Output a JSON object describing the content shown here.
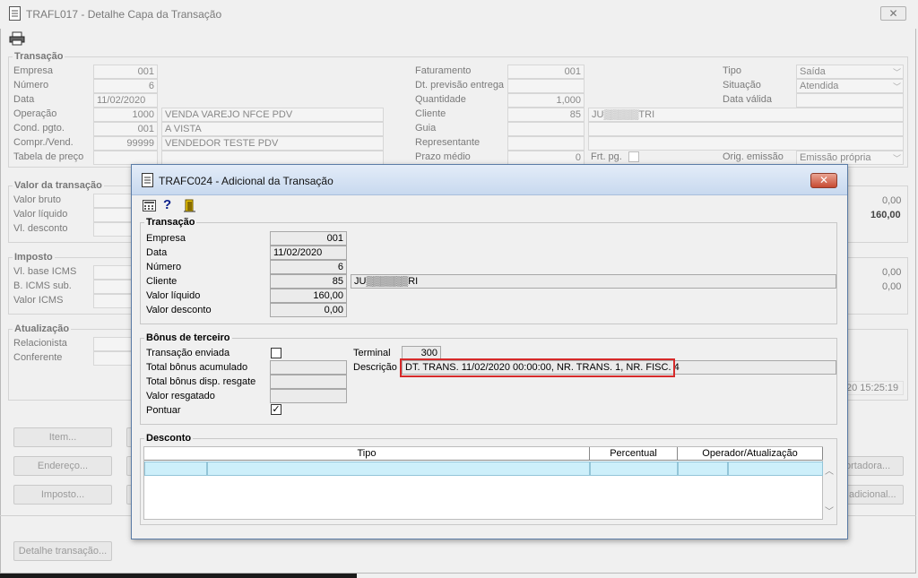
{
  "main": {
    "title": "TRAFL017 - Detalhe Capa da Transação",
    "close": "✕",
    "transacao": {
      "title": "Transação",
      "empresa_label": "Empresa",
      "empresa": "001",
      "numero_label": "Número",
      "numero": "6",
      "data_label": "Data",
      "data": "11/02/2020",
      "operacao_label": "Operação",
      "operacao_code": "1000",
      "operacao_desc": "VENDA VAREJO NFCE PDV",
      "cond_label": "Cond. pgto.",
      "cond_code": "001",
      "cond_desc": "A VISTA",
      "compr_label": "Compr./Vend.",
      "compr_code": "99999",
      "compr_desc": "VENDEDOR TESTE PDV",
      "tabela_label": "Tabela de preço",
      "faturamento_label": "Faturamento",
      "faturamento": "001",
      "dt_prev_label": "Dt. previsão entrega",
      "quantidade_label": "Quantidade",
      "quantidade": "1,000",
      "cliente_label": "Cliente",
      "cliente_code": "85",
      "cliente_name": "JU▒▒▒▒▒TRI",
      "guia_label": "Guia",
      "representante_label": "Representante",
      "prazo_label": "Prazo médio",
      "prazo": "0",
      "frt_label": "Frt. pg.",
      "tipo_label": "Tipo",
      "tipo": "Saída",
      "situacao_label": "Situação",
      "situacao": "Atendida",
      "data_valida_label": "Data válida",
      "orig_label": "Orig. emissão",
      "orig": "Emissão própria"
    },
    "valor": {
      "title": "Valor da transação",
      "bruto_label": "Valor bruto",
      "liquido_label": "Valor líquido",
      "desconto_label": "Vl. desconto",
      "right1": "0,00",
      "right2": "160,00"
    },
    "imposto": {
      "title": "Imposto",
      "base_label": "Vl. base ICMS",
      "sub_label": "B. ICMS sub.",
      "icms_label": "Valor ICMS",
      "right1": "0,00",
      "right2": "0,00"
    },
    "atualizacao": {
      "title": "Atualização",
      "relacionista_label": "Relacionista",
      "conferente_label": "Conferente",
      "timestamp": "20 15:25:19"
    },
    "buttons": {
      "item": "Item...",
      "endereco": "Endereço...",
      "imposto": "Imposto...",
      "transportadora": "ortadora...",
      "adicional": "adicional...",
      "detalhe": "Detalhe transação..."
    }
  },
  "dialog": {
    "title": "TRAFC024 - Adicional da Transação",
    "close": "✕",
    "toolbar": {
      "help": "?"
    },
    "transacao": {
      "title": "Transação",
      "empresa_label": "Empresa",
      "empresa": "001",
      "data_label": "Data",
      "data": "11/02/2020",
      "numero_label": "Número",
      "numero": "6",
      "cliente_label": "Cliente",
      "cliente_code": "85",
      "cliente_name": "JU▒▒▒▒▒▒RI",
      "liquido_label": "Valor líquido",
      "liquido": "160,00",
      "desconto_label": "Valor desconto",
      "desconto": "0,00"
    },
    "bonus": {
      "title": "Bônus de terceiro",
      "enviada_label": "Transação enviada",
      "acumulado_label": "Total bônus acumulado",
      "disp_label": "Total bônus disp. resgate",
      "resgatado_label": "Valor resgatado",
      "pontuar_label": "Pontuar",
      "pontuar_check": "✓",
      "terminal_label": "Terminal",
      "terminal": "300",
      "descricao_label": "Descrição",
      "descricao": "DT. TRANS. 11/02/2020 00:00:00, NR. TRANS. 1, NR. FISC. 4"
    },
    "desconto": {
      "title": "Desconto",
      "columns": [
        "Tipo",
        "Percentual",
        "Operador/Atualização"
      ]
    }
  }
}
